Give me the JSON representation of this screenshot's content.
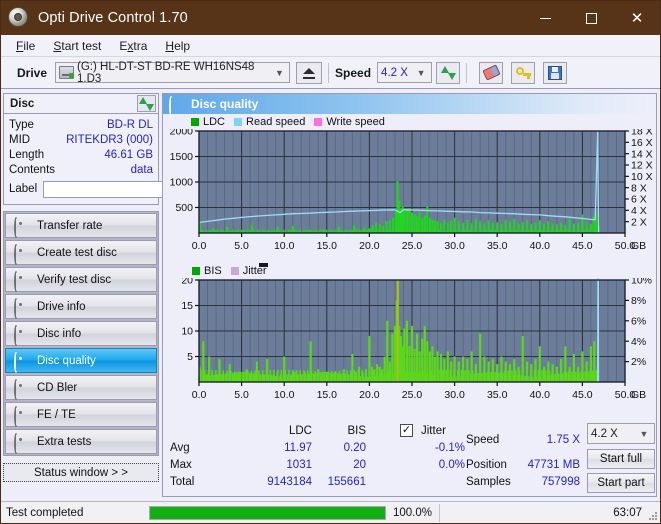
{
  "window": {
    "title": "Opti Drive Control 1.70",
    "icon": "disc-icon",
    "minimize_label": "–",
    "maximize_label": "□",
    "close_label": "✕"
  },
  "menu": {
    "items": [
      {
        "label": "File"
      },
      {
        "label": "Start test"
      },
      {
        "label": "Extra"
      },
      {
        "label": "Help"
      }
    ]
  },
  "toolbar": {
    "drive_label": "Drive",
    "drive_value": "(G:)  HL-DT-ST BD-RE  WH16NS48 1.D3",
    "eject_icon": "eject-icon",
    "speed_label": "Speed",
    "speed_value": "4.2 X",
    "refresh_icon": "refresh-icon",
    "erase_icon": "erase-icon",
    "key_icon": "key-icon",
    "save_icon": "save-icon"
  },
  "disc_panel": {
    "title": "Disc",
    "refresh_icon": "refresh-icon",
    "rows": [
      {
        "key": "Type",
        "value": "BD-R DL"
      },
      {
        "key": "MID",
        "value": "RITEKDR3 (000)"
      },
      {
        "key": "Length",
        "value": "46.61 GB"
      },
      {
        "key": "Contents",
        "value": "data"
      }
    ],
    "label_key": "Label",
    "label_value": "",
    "label_placeholder": "",
    "label_button_icon": "disc-icon"
  },
  "nav": {
    "items": [
      {
        "label": "Transfer rate",
        "active": false
      },
      {
        "label": "Create test disc",
        "active": false
      },
      {
        "label": "Verify test disc",
        "active": false
      },
      {
        "label": "Drive info",
        "active": false
      },
      {
        "label": "Disc info",
        "active": false
      },
      {
        "label": "Disc quality",
        "active": true
      },
      {
        "label": "CD Bler",
        "active": false
      },
      {
        "label": "FE / TE",
        "active": false
      },
      {
        "label": "Extra tests",
        "active": false
      }
    ],
    "status_window_label": "Status window > >"
  },
  "panel": {
    "title": "Disc quality",
    "icon": "disc-quality-icon"
  },
  "chart_data": [
    {
      "type": "area",
      "id": "ldc-chart",
      "title": "",
      "xlabel": "GB",
      "ylabel": "",
      "xlim": [
        0,
        50
      ],
      "ylim": [
        0,
        2000
      ],
      "y2lim": [
        0,
        18
      ],
      "y2label": "X",
      "grid": true,
      "legend_position": "top-left",
      "legend": [
        {
          "name": "LDC",
          "color": "#00a800"
        },
        {
          "name": "Read speed",
          "color": "#7fd4f5"
        },
        {
          "name": "Write speed",
          "color": "#ff6ee0"
        }
      ],
      "xticks": [
        "0.0",
        "5.0",
        "10.0",
        "15.0",
        "20.0",
        "25.0",
        "30.0",
        "35.0",
        "40.0",
        "45.0",
        "50.0"
      ],
      "yticks": [
        "500",
        "1000",
        "1500",
        "2000"
      ],
      "y2ticks": [
        "2 X",
        "4 X",
        "6 X",
        "8 X",
        "10 X",
        "12 X",
        "14 X",
        "16 X",
        "18 X"
      ],
      "series": [
        {
          "name": "LDC",
          "color": "#22d422",
          "x": [
            0.1,
            0.4,
            0.8,
            1.2,
            1.7,
            2.2,
            2.8,
            3.3,
            3.9,
            4.4,
            5.0,
            5.6,
            6.2,
            6.8,
            7.4,
            8.0,
            8.6,
            9.2,
            9.8,
            10.4,
            11.0,
            11.6,
            12.2,
            12.8,
            13.4,
            14.0,
            14.6,
            15.2,
            15.8,
            16.4,
            17.0,
            17.6,
            18.2,
            18.8,
            19.4,
            20.0,
            20.4,
            20.8,
            21.2,
            21.6,
            22.0,
            22.4,
            22.8,
            23.1,
            23.3,
            23.5,
            23.7,
            23.9,
            24.1,
            24.4,
            24.7,
            25.0,
            25.3,
            25.6,
            25.9,
            26.2,
            26.5,
            26.8,
            27.1,
            27.4,
            27.7,
            28.0,
            28.4,
            28.8,
            29.2,
            29.6,
            30.0,
            30.5,
            31.0,
            31.5,
            32.0,
            32.5,
            33.0,
            33.5,
            34.0,
            34.5,
            35.0,
            35.5,
            36.0,
            36.5,
            37.0,
            37.5,
            38.0,
            38.5,
            39.0,
            39.5,
            40.0,
            40.5,
            41.0,
            41.5,
            42.0,
            42.5,
            43.0,
            43.5,
            44.0,
            44.5,
            45.0,
            45.5,
            46.0,
            46.3,
            46.6,
            46.9
          ],
          "values": [
            210,
            60,
            40,
            35,
            90,
            45,
            35,
            120,
            40,
            35,
            55,
            30,
            160,
            35,
            30,
            45,
            30,
            120,
            35,
            30,
            140,
            35,
            30,
            55,
            35,
            30,
            70,
            35,
            40,
            120,
            35,
            45,
            150,
            60,
            110,
            90,
            150,
            200,
            170,
            140,
            230,
            250,
            300,
            420,
            1010,
            640,
            470,
            520,
            430,
            470,
            480,
            400,
            370,
            330,
            420,
            290,
            340,
            520,
            300,
            260,
            240,
            230,
            200,
            260,
            210,
            240,
            300,
            230,
            200,
            260,
            190,
            280,
            230,
            190,
            250,
            200,
            210,
            180,
            260,
            220,
            280,
            180,
            210,
            240,
            180,
            200,
            250,
            180,
            230,
            190,
            170,
            200,
            160,
            300,
            180,
            200,
            360,
            200,
            180,
            330,
            400,
            150
          ]
        },
        {
          "name": "Read speed",
          "color": "#9fdcf8",
          "x": [
            0.0,
            1.0,
            2.0,
            3.0,
            4.0,
            5.0,
            6.0,
            7.0,
            8.0,
            9.0,
            10.0,
            11.0,
            12.0,
            13.0,
            14.0,
            15.0,
            16.0,
            17.0,
            18.0,
            19.0,
            20.0,
            21.0,
            22.0,
            23.0,
            23.6,
            24.0,
            25.0,
            26.0,
            27.0,
            28.0,
            29.0,
            30.0,
            31.0,
            32.0,
            33.0,
            34.0,
            35.0,
            36.0,
            37.0,
            38.0,
            39.0,
            40.0,
            41.0,
            42.0,
            43.0,
            44.0,
            45.0,
            46.0,
            46.5,
            46.8,
            46.9
          ],
          "values": [
            1.85,
            2.05,
            2.25,
            2.45,
            2.6,
            2.75,
            2.9,
            3.0,
            3.1,
            3.2,
            3.3,
            3.4,
            3.45,
            3.5,
            3.6,
            3.65,
            3.7,
            3.8,
            3.85,
            3.9,
            3.95,
            4.0,
            4.05,
            4.1,
            3.6,
            4.1,
            4.05,
            4.0,
            3.95,
            3.9,
            3.85,
            3.8,
            3.75,
            3.7,
            3.6,
            3.55,
            3.5,
            3.45,
            3.4,
            3.3,
            3.25,
            3.2,
            3.05,
            2.95,
            2.85,
            2.7,
            2.55,
            2.4,
            2.35,
            18.0,
            0.0
          ]
        }
      ]
    },
    {
      "type": "area",
      "id": "bis-chart",
      "title": "",
      "xlabel": "GB",
      "ylabel": "",
      "xlim": [
        0,
        50
      ],
      "ylim": [
        0,
        20
      ],
      "y2lim": [
        0,
        10
      ],
      "y2label": "%",
      "grid": true,
      "legend_position": "top-left",
      "legend": [
        {
          "name": "BIS",
          "color": "#00a800"
        },
        {
          "name": "Jitter",
          "color": "#c9a8d8"
        }
      ],
      "xticks": [
        "0.0",
        "5.0",
        "10.0",
        "15.0",
        "20.0",
        "25.0",
        "30.0",
        "35.0",
        "40.0",
        "45.0",
        "50.0"
      ],
      "yticks": [
        "5",
        "10",
        "15",
        "20"
      ],
      "y2ticks": [
        "2%",
        "4%",
        "6%",
        "8%",
        "10%"
      ],
      "series": [
        {
          "name": "BIS",
          "color": "#5cd81a",
          "x": [
            0.1,
            0.5,
            0.9,
            1.2,
            1.6,
            2.0,
            2.4,
            2.8,
            3.2,
            3.6,
            4.0,
            4.4,
            4.8,
            5.2,
            5.6,
            6.0,
            6.4,
            6.8,
            7.2,
            7.6,
            8.0,
            8.4,
            8.8,
            9.2,
            9.6,
            10.0,
            10.4,
            10.8,
            11.2,
            11.6,
            12.0,
            12.4,
            12.8,
            13.1,
            13.5,
            14.0,
            14.5,
            15.0,
            15.5,
            16.0,
            16.5,
            17.0,
            17.5,
            18.0,
            18.4,
            18.8,
            19.2,
            19.6,
            20.0,
            20.3,
            20.6,
            20.9,
            21.2,
            21.5,
            21.8,
            22.1,
            22.4,
            22.7,
            23.0,
            23.2,
            23.35,
            23.5,
            23.7,
            23.9,
            24.1,
            24.4,
            24.7,
            25.0,
            25.3,
            25.6,
            25.9,
            26.2,
            26.5,
            26.8,
            27.1,
            27.4,
            27.7,
            28.0,
            28.4,
            28.8,
            29.2,
            29.6,
            30.0,
            30.5,
            31.0,
            31.5,
            32.0,
            32.5,
            33.0,
            33.5,
            34.0,
            34.5,
            35.0,
            35.5,
            36.0,
            36.5,
            37.0,
            37.5,
            38.0,
            38.5,
            39.0,
            39.5,
            40.0,
            40.5,
            41.0,
            41.5,
            42.0,
            42.5,
            43.0,
            43.5,
            44.0,
            44.5,
            45.0,
            45.5,
            46.0,
            46.4,
            46.8
          ],
          "values": [
            3.0,
            8.0,
            1.5,
            5.0,
            1.5,
            1.5,
            4.5,
            1.5,
            1.5,
            3.5,
            1.5,
            1.5,
            2.0,
            1.5,
            2.5,
            1.5,
            1.5,
            4.0,
            1.5,
            1.5,
            4.5,
            1.5,
            1.5,
            2.0,
            1.5,
            5.0,
            1.5,
            1.5,
            2.0,
            1.5,
            1.5,
            2.0,
            1.5,
            8.0,
            1.5,
            2.5,
            1.5,
            2.0,
            1.5,
            2.0,
            1.5,
            2.5,
            1.5,
            5.5,
            2.0,
            3.0,
            2.0,
            2.5,
            9.0,
            3.0,
            2.5,
            3.5,
            3.0,
            2.5,
            5.0,
            12.0,
            4.0,
            9.5,
            11.0,
            16.0,
            20.0,
            11.0,
            9.0,
            7.0,
            10.5,
            12.0,
            7.0,
            11.0,
            6.5,
            9.5,
            6.0,
            8.5,
            11.0,
            8.0,
            6.0,
            7.0,
            5.0,
            6.0,
            5.5,
            4.5,
            6.0,
            4.0,
            5.0,
            4.0,
            5.0,
            4.5,
            6.0,
            3.5,
            9.5,
            5.0,
            4.0,
            4.5,
            3.5,
            5.0,
            4.0,
            3.5,
            4.5,
            3.0,
            9.0,
            4.0,
            3.5,
            4.5,
            7.0,
            3.0,
            4.0,
            3.5,
            3.0,
            4.5,
            7.0,
            3.0,
            5.5,
            3.0,
            6.0,
            4.0,
            7.0,
            8.0,
            3.0
          ]
        },
        {
          "name": "Jitter",
          "color": "#c9b21a",
          "x": [
            23.3
          ],
          "values": [
            20.0
          ]
        },
        {
          "name": "Read speed",
          "color": "#9fdcf8",
          "x": [
            46.8,
            46.85,
            46.9
          ],
          "values": [
            0.0,
            20.0,
            0.0
          ]
        }
      ]
    }
  ],
  "stats": {
    "col_headers": [
      "LDC",
      "BIS"
    ],
    "rows": [
      {
        "label": "Avg",
        "ldc": "11.97",
        "bis": "0.20",
        "jitter": "-0.1%"
      },
      {
        "label": "Max",
        "ldc": "1031",
        "bis": "20",
        "jitter": "0.0%"
      },
      {
        "label": "Total",
        "ldc": "9143184",
        "bis": "155661",
        "jitter": ""
      }
    ],
    "jitter_label": "Jitter",
    "jitter_checked": true,
    "speed_label": "Speed",
    "speed_value": "1.75 X",
    "position_label": "Position",
    "position_value": "47731 MB",
    "samples_label": "Samples",
    "samples_value": "757998",
    "speed_select_value": "4.2 X",
    "start_full_label": "Start full",
    "start_part_label": "Start part"
  },
  "statusbar": {
    "message": "Test completed",
    "progress_percent": 100.0,
    "progress_text": "100.0%",
    "elapsed": "63:07"
  },
  "colors": {
    "title_bar": "#573317",
    "accent_blue": "#1aa8ef",
    "value_blue": "#2323c8",
    "plot_bg": "#6b7d99",
    "ldc_green": "#22d422",
    "read_speed": "#9fdcf8",
    "progress_green": "#12b012"
  }
}
